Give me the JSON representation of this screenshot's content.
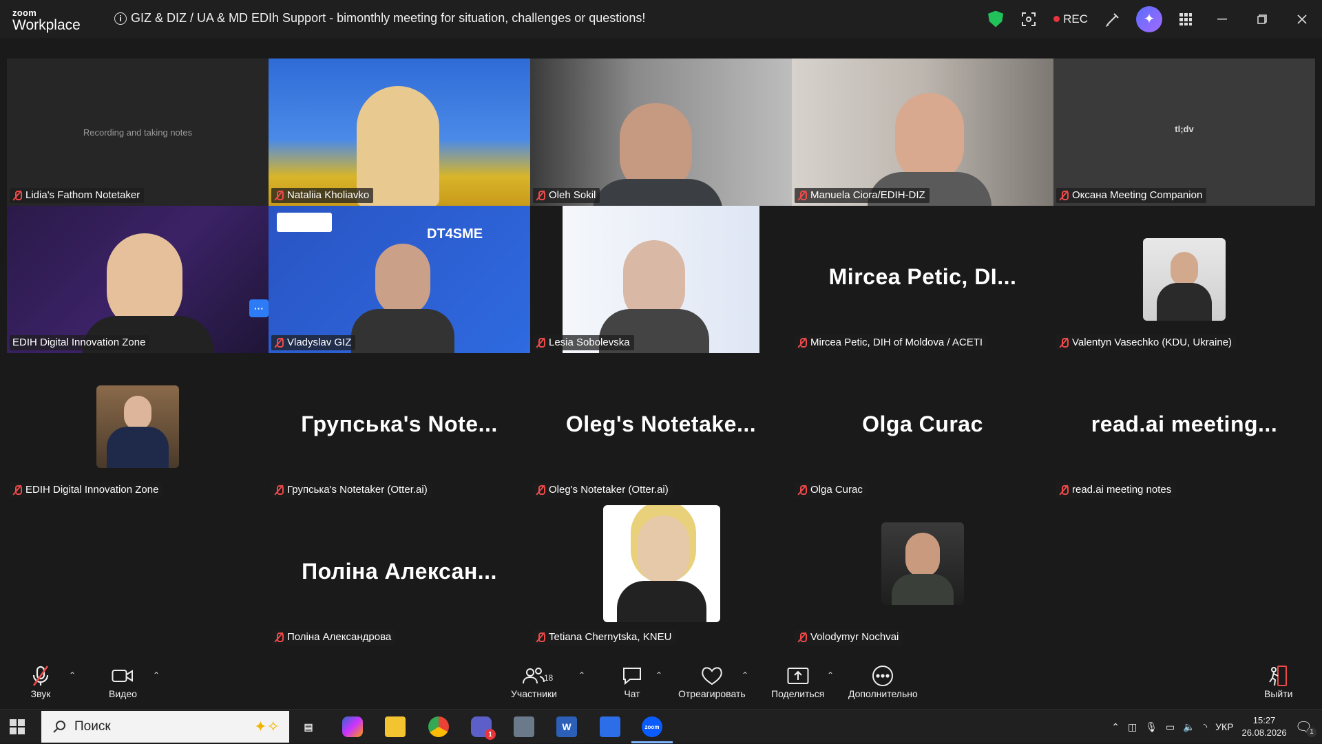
{
  "app": {
    "logo_top": "zoom",
    "logo_bottom": "Workplace"
  },
  "meeting": {
    "title": "GIZ & DIZ / UA & MD EDIh Support - bimonthly meeting for situation, challenges or questions!"
  },
  "titlebar": {
    "rec_label": "REC"
  },
  "tiles": [
    {
      "name": "Lidia's Fathom Notetaker",
      "note": "Recording and taking notes"
    },
    {
      "name": "Nataliia Kholiavko"
    },
    {
      "name": "Oleh Sokil"
    },
    {
      "name": "Manuela Ciora/EDIH-DIZ"
    },
    {
      "name": "Оксана Meeting Companion",
      "note": "tl;dv"
    },
    {
      "name": "EDIH Digital Innovation Zone"
    },
    {
      "name": "Vladyslav GIZ",
      "note": "DT4SME"
    },
    {
      "name": "Lesia Sobolevska"
    },
    {
      "name": "Mircea Petic, DIH of Moldova / ACETI",
      "big": "Mircea  Petic,  DI..."
    },
    {
      "name": "Valentyn Vasechko (KDU, Ukraine)"
    },
    {
      "name": "EDIH Digital Innovation Zone"
    },
    {
      "name": "Групська's Notetaker (Otter.ai)",
      "big": "Групська's  Note..."
    },
    {
      "name": "Oleg's Notetaker (Otter.ai)",
      "big": "Oleg's  Notetake..."
    },
    {
      "name": "Olga Curac",
      "big": "Olga Curac"
    },
    {
      "name": "read.ai meeting notes",
      "big": "read.ai  meeting..."
    },
    {
      "name": "Поліна Александрова",
      "big": "Поліна  Алексан..."
    },
    {
      "name": "Tetiana Chernytska, KNEU"
    },
    {
      "name": "Volodymyr Nochvai"
    }
  ],
  "controls": {
    "audio": "Звук",
    "video": "Видео",
    "participants": "Участники",
    "participants_count": "18",
    "chat": "Чат",
    "react": "Отреагировать",
    "share": "Поделиться",
    "more": "Дополнительно",
    "leave": "Выйти"
  },
  "taskbar": {
    "search_placeholder": "Поиск",
    "lang": "УКР",
    "time": "15:27",
    "date": "26.08.2026",
    "teams_badge": "1",
    "notif_badge": "1"
  },
  "colors": {
    "active_speaker": "#34c78a",
    "mic_muted": "#ef4a4a",
    "rec": "#e5363d",
    "more_button": "#2d7cf6"
  }
}
